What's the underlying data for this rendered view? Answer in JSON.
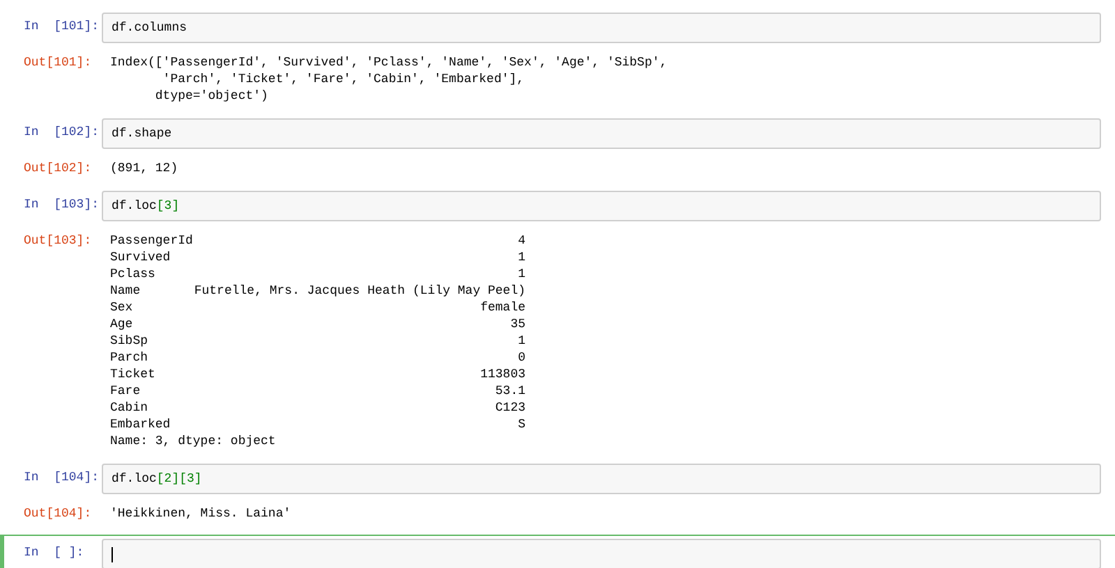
{
  "cells": [
    {
      "prompt_in": "In  [101]:",
      "code": [
        {
          "kind": "plain",
          "text": "df.columns"
        }
      ],
      "selected": false,
      "output": {
        "kind": "text",
        "prompt": "Out[101]:",
        "text": "Index(['PassengerId', 'Survived', 'Pclass', 'Name', 'Sex', 'Age', 'SibSp',\n       'Parch', 'Ticket', 'Fare', 'Cabin', 'Embarked'],\n      dtype='object')"
      }
    },
    {
      "prompt_in": "In  [102]:",
      "code": [
        {
          "kind": "plain",
          "text": "df.shape"
        }
      ],
      "selected": false,
      "output": {
        "kind": "text",
        "prompt": "Out[102]:",
        "text": "(891, 12)"
      }
    },
    {
      "prompt_in": "In  [103]:",
      "code": [
        {
          "kind": "plain",
          "text": "df.loc"
        },
        {
          "kind": "number",
          "text": "[3]"
        }
      ],
      "selected": false,
      "output": {
        "kind": "series",
        "prompt": "Out[103]:",
        "rows": [
          {
            "label": "PassengerId",
            "value": "4"
          },
          {
            "label": "Survived",
            "value": "1"
          },
          {
            "label": "Pclass",
            "value": "1"
          },
          {
            "label": "Name",
            "value": "Futrelle, Mrs. Jacques Heath (Lily May Peel)"
          },
          {
            "label": "Sex",
            "value": "female"
          },
          {
            "label": "Age",
            "value": "35"
          },
          {
            "label": "SibSp",
            "value": "1"
          },
          {
            "label": "Parch",
            "value": "0"
          },
          {
            "label": "Ticket",
            "value": "113803"
          },
          {
            "label": "Fare",
            "value": "53.1"
          },
          {
            "label": "Cabin",
            "value": "C123"
          },
          {
            "label": "Embarked",
            "value": "S"
          }
        ],
        "footer": "Name: 3, dtype: object"
      }
    },
    {
      "prompt_in": "In  [104]:",
      "code": [
        {
          "kind": "plain",
          "text": "df.loc"
        },
        {
          "kind": "number",
          "text": "[2]"
        },
        {
          "kind": "number",
          "text": "[3]"
        }
      ],
      "selected": false,
      "output": {
        "kind": "text",
        "prompt": "Out[104]:",
        "text": "'Heikkinen, Miss. Laina'"
      }
    },
    {
      "prompt_in": "In  [ ]:",
      "selected": true
    }
  ]
}
